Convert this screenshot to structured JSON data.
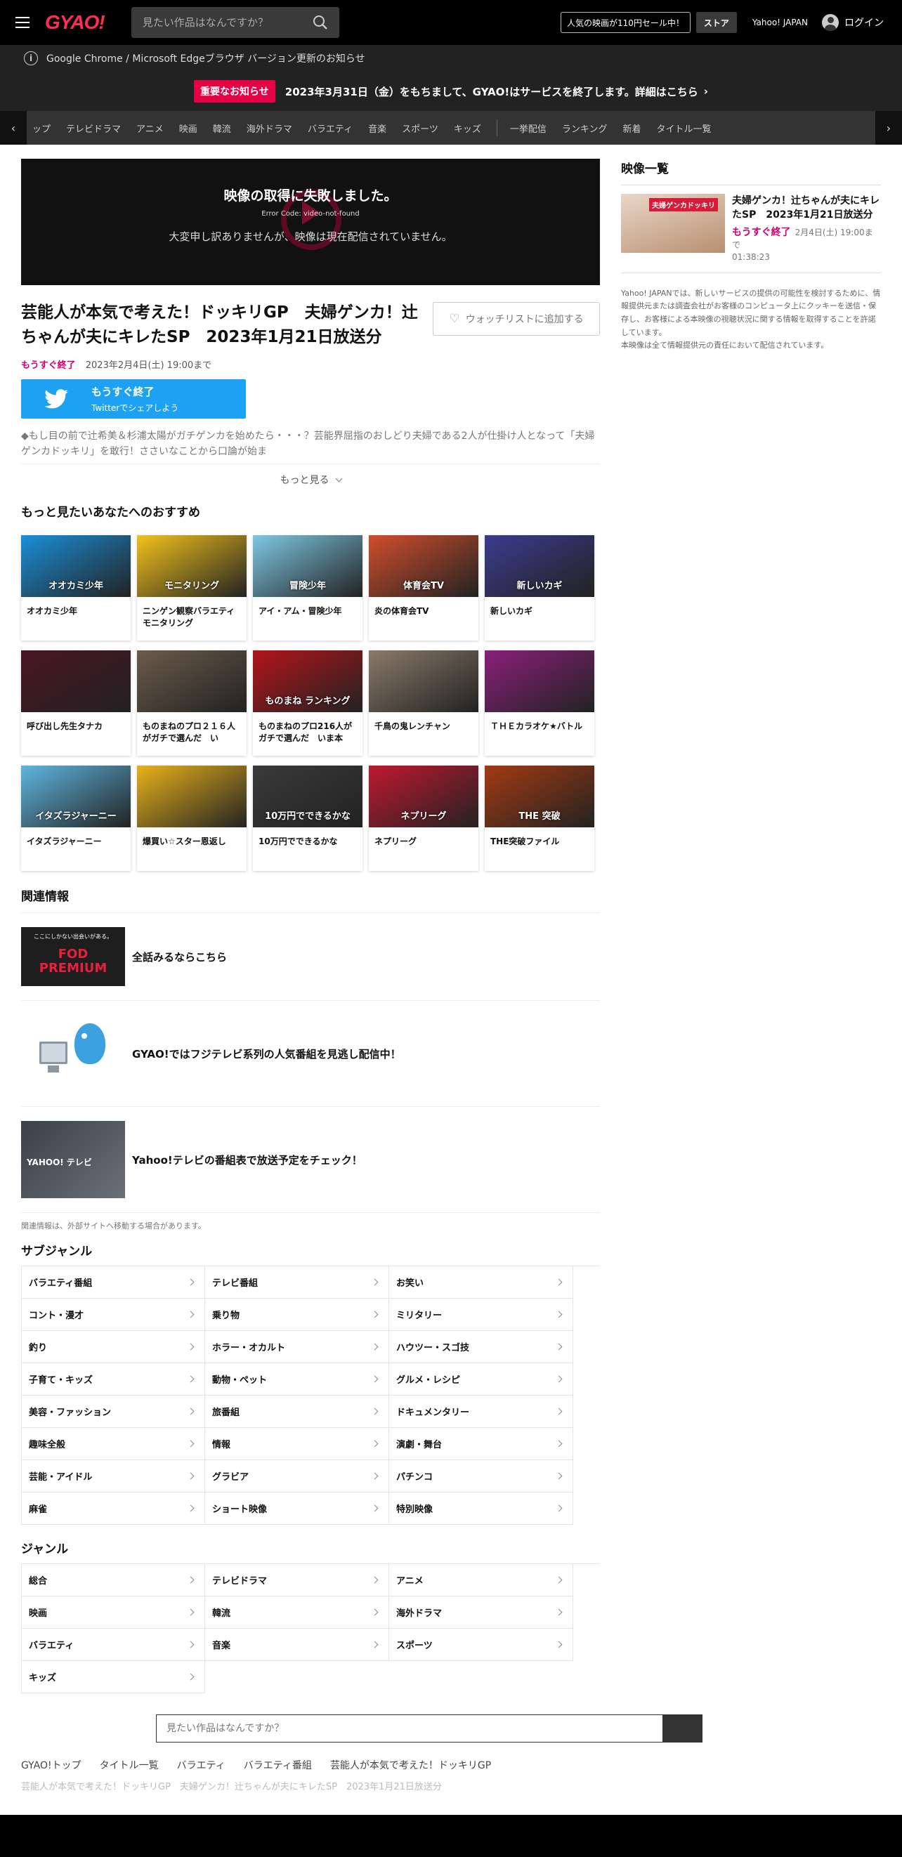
{
  "header": {
    "logo": "GYAO!",
    "search_placeholder": "見たい作品はなんですか？",
    "sale_label": "人気の映画が110円セール中！",
    "store_label": "ストア",
    "yahoo_label": "Yahoo! JAPAN",
    "login_label": "ログイン"
  },
  "browser_notice": "Google Chrome / Microsoft Edgeブラウザ バージョン更新のお知らせ",
  "important_notice": {
    "badge": "重要なお知らせ",
    "text": "2023年3月31日（金）をもちまして、GYAO!はサービスを終了します。詳細はこちら"
  },
  "genre_nav": {
    "items": [
      "ップ",
      "テレビドラマ",
      "アニメ",
      "映画",
      "韓流",
      "海外ドラマ",
      "バラエティ",
      "音楽",
      "スポーツ",
      "キッズ"
    ],
    "items_after": [
      "一挙配信",
      "ランキング",
      "新着",
      "タイトル一覧"
    ]
  },
  "player": {
    "error_title": "映像の取得に失敗しました。",
    "error_code": "Error Code: video-not-found",
    "error_message": "大変申し訳ありませんが、映像は現在配信されていません。"
  },
  "episode": {
    "title": "芸能人が本気で考えた！ドッキリGP　夫婦ゲンカ！辻ちゃんが夫にキレたSP　2023年1月21日放送分",
    "status": "もうすぐ終了",
    "deadline": "2023年2月4日(土) 19:00まで",
    "watchlist_label": "ウォッチリストに追加する",
    "twitter_line1": "もうすぐ終了",
    "twitter_line2": "Twitterでシェアしよう",
    "description": "◆もし目の前で辻希美＆杉浦太陽がガチゲンカを始めたら・・・？芸能界屈指のおしどり夫婦である2人が仕掛け人となって「夫婦ゲンカドッキリ」を敢行！ささいなことから口論が始ま",
    "more_label": "もっと見る"
  },
  "recommend": {
    "title": "もっと見たいあなたへのおすすめ",
    "items": [
      {
        "name": "オオカミ少年",
        "thumb_text": "オオカミ少年",
        "color": "#1a8fd8"
      },
      {
        "name": "ニンゲン観察バラエティ モニタリング",
        "thumb_text": "モニタリング",
        "color": "#f3c21b"
      },
      {
        "name": "アイ・アム・冒険少年",
        "thumb_text": "冒険少年",
        "color": "#7ec8e3"
      },
      {
        "name": "炎の体育会TV",
        "thumb_text": "体育会TV",
        "color": "#d14d2c"
      },
      {
        "name": "新しいカギ",
        "thumb_text": "新しいカギ",
        "color": "#3b3b8f"
      },
      {
        "name": "呼び出し先生タナカ",
        "thumb_text": "",
        "color": "#4a1524"
      },
      {
        "name": "ものまねのプロ２１６人がガチで選んだ　い",
        "thumb_text": "",
        "color": "#6b5b4b"
      },
      {
        "name": "ものまねのプロ216人がガチで選んだ　いま本",
        "thumb_text": "ものまね ランキング",
        "color": "#b3141a"
      },
      {
        "name": "千鳥の鬼レンチャン",
        "thumb_text": "",
        "color": "#8a7a6a"
      },
      {
        "name": "ＴＨＥカラオケ★バトル",
        "thumb_text": "",
        "color": "#8a1f7a"
      },
      {
        "name": "イタズラジャーニー",
        "thumb_text": "イタズラジャーニー",
        "color": "#5fb6e0"
      },
      {
        "name": "爆買い☆スター恩返し",
        "thumb_text": "",
        "color": "#e8b21a"
      },
      {
        "name": "10万円でできるかな",
        "thumb_text": "10万円でできるかな",
        "color": "#3a3a3a"
      },
      {
        "name": "ネプリーグ",
        "thumb_text": "ネプリーグ",
        "color": "#c0182f"
      },
      {
        "name": "THE突破ファイル",
        "thumb_text": "THE 突破",
        "color": "#a33a12"
      }
    ]
  },
  "related": {
    "title": "関連情報",
    "items": [
      {
        "text": "全話みるならこちら",
        "thumb_text": "FOD PREMIUM",
        "thumb_sub": "ここにしかない出会いがある。"
      },
      {
        "text": "GYAO!ではフジテレビ系列の人気番組を見逃し配信中！",
        "thumb_text": ""
      },
      {
        "text": "Yahoo!テレビの番組表で放送予定をチェック！",
        "thumb_text": "YAHOO! テレビ"
      }
    ],
    "note": "関連情報は、外部サイトへ移動する場合があります。"
  },
  "subgenre": {
    "title": "サブジャンル",
    "items": [
      "バラエティ番組",
      "テレビ番組",
      "お笑い",
      "コント・漫才",
      "乗り物",
      "ミリタリー",
      "釣り",
      "ホラー・オカルト",
      "ハウツー・スゴ技",
      "子育て・キッズ",
      "動物・ペット",
      "グルメ・レシピ",
      "美容・ファッション",
      "旅番組",
      "ドキュメンタリー",
      "趣味全般",
      "情報",
      "演劇・舞台",
      "芸能・アイドル",
      "グラビア",
      "パチンコ",
      "麻雀",
      "ショート映像",
      "特別映像"
    ]
  },
  "genre": {
    "title": "ジャンル",
    "items": [
      "総合",
      "テレビドラマ",
      "アニメ",
      "映画",
      "韓流",
      "海外ドラマ",
      "バラエティ",
      "音楽",
      "スポーツ",
      "キッズ"
    ]
  },
  "bottom_search_placeholder": "見たい作品はなんですか？",
  "breadcrumbs": [
    "GYAO!トップ",
    "タイトル一覧",
    "バラエティ",
    "バラエティ番組",
    "芸能人が本気で考えた！ドッキリGP"
  ],
  "breadcrumb_current": "芸能人が本気で考えた！ドッキリGP　夫婦ゲンカ！辻ちゃんが夫にキレたSP　2023年1月21日放送分",
  "side": {
    "title": "映像一覧",
    "item": {
      "title": "夫婦ゲンカ！辻ちゃんが夫にキレたSP　2023年1月21日放送分",
      "status": "もうすぐ終了",
      "deadline": "2月4日(土) 19:00まで",
      "duration": "01:38:23",
      "thumb_text": "夫婦ゲンカドッキリ"
    },
    "disclaimer_1": "Yahoo! JAPANでは、新しいサービスの提供の可能性を検討するために、情報提供元または調査会社がお客様のコンピュータ上にクッキーを送信・保存し、お客様による本映像の視聴状況に関する情報を取得することを許諾しています。",
    "disclaimer_2": "本映像は全て情報提供元の責任において配信されています。"
  },
  "colors": {
    "brand": "#ff2d55",
    "important": "#e60044",
    "ending_soon": "#d0006f",
    "twitter": "#1da1f2"
  }
}
